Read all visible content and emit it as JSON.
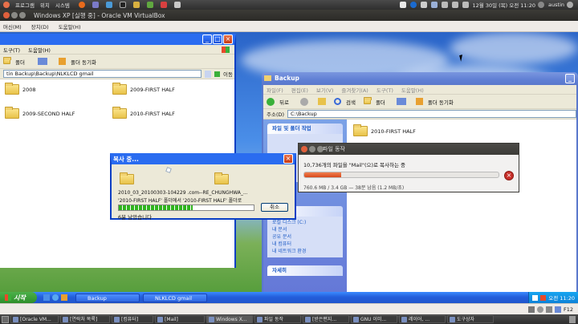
{
  "ubuntu_top": {
    "menus": [
      "프로그램",
      "위치",
      "시스템"
    ],
    "clock": "12월 30일 (목) 오전 11:20",
    "user": "austin"
  },
  "vbox": {
    "title": "Windows XP [실행 중] - Oracle VM VirtualBox",
    "menu": [
      "머신(M)",
      "장치(D)",
      "도움말(H)"
    ]
  },
  "left_window": {
    "menu": [
      "도구(T)",
      "도움말(H)"
    ],
    "toolbar": {
      "folders_label": "폴더",
      "sync_label": "폴더 동기화"
    },
    "address": "tin Backup\\Backup\\NLKLCD gmail",
    "go_label": "이동",
    "folders": [
      "2008",
      "2009-FIRST HALF",
      "2009-SECOND HALF",
      "2010-FIRST HALF"
    ]
  },
  "right_window": {
    "title": "Backup",
    "menu": [
      "파일(F)",
      "편집(E)",
      "보기(V)",
      "즐겨찾기(A)",
      "도구(T)",
      "도움말(H)"
    ],
    "toolbar": {
      "back_label": "뒤로",
      "search_label": "검색",
      "folders_label": "폴더",
      "sync_label": "폴더 동기화"
    },
    "address_label": "주소(D)",
    "address": "C:\\Backup",
    "task_header": "파일 및 폴더 작업",
    "other_header": "기타 위치",
    "other_items": [
      "로컬 디스크 (C:)",
      "내 문서",
      "공유 문서",
      "내 컴퓨터",
      "내 네트워크 환경"
    ],
    "details_header": "자세히",
    "folders": [
      "2010-FIRST HALF"
    ]
  },
  "copy_dialog": {
    "title": "복사 중...",
    "file_line": "2010_03_20100303-104229 .com--RE_CHUNGHWA_...",
    "dest_line": "'2010-FIRST HALF' 폴더에서 '2010-FIRST HALF' 폴더로",
    "progress": 0.55,
    "cancel_label": "취소",
    "remaining": "6분 남았습니다"
  },
  "gnome_dialog": {
    "title": "파일 동작",
    "message": "10,736개의 파일을 \"Mail\"(으)로 복사하는 중",
    "progress": 0.19,
    "detail": "760.6 MB / 3.4 GB — 38분 남음 (1.2 MB/초)"
  },
  "xp_taskbar": {
    "start_label": "시작",
    "tasks": [
      "Backup",
      "NLKLCD gmail"
    ],
    "tray_time": "오전 11:20"
  },
  "ubuntu_bottom": {
    "tasks": [
      "[Oracle VM...",
      "[연락처 목록]",
      "[컴퓨터]",
      "[Mail]",
      "Windows X...",
      "파일 동작",
      "[받은편지...",
      "GNU 이미...",
      "레이어, ...",
      "도구상자"
    ]
  },
  "colors": {
    "xp_blue": "#0a3fc4",
    "progress_green": "#2fb41c",
    "gnome_progress": "#e05a2a"
  }
}
